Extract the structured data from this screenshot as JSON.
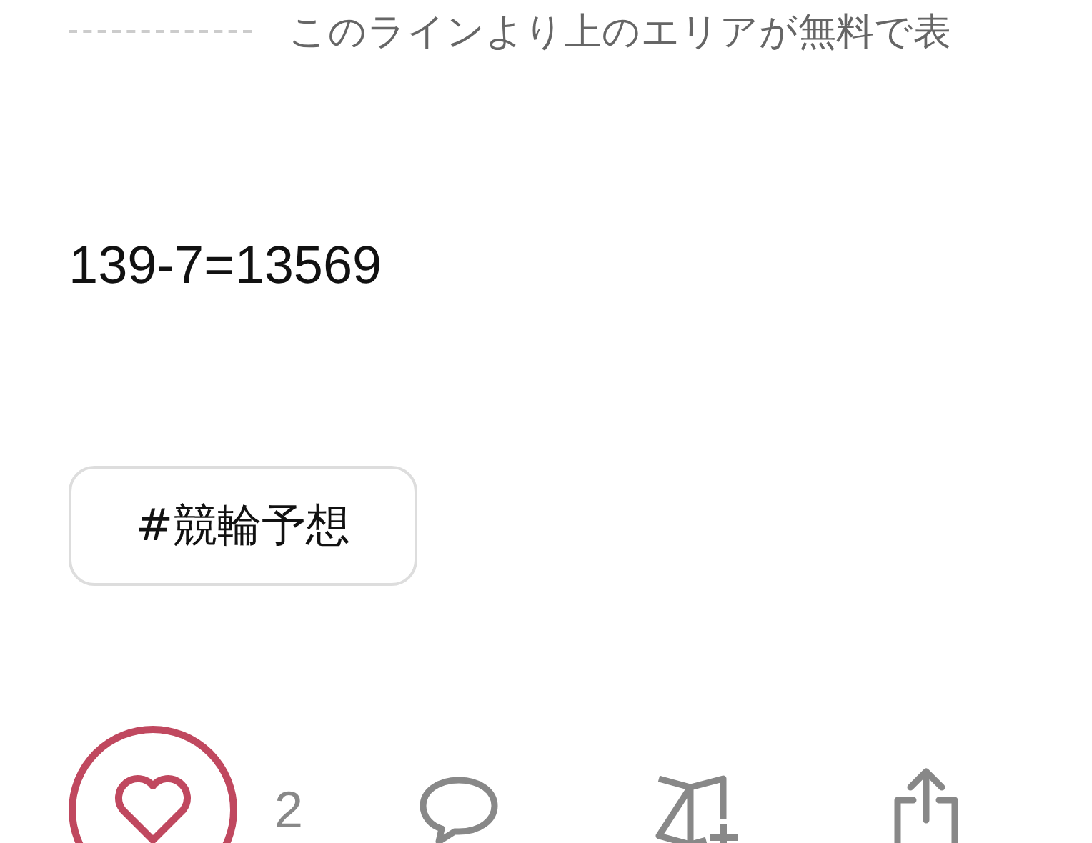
{
  "paywall_notice": {
    "text": "このラインより上のエリアが無料で表"
  },
  "body": {
    "text": "139-7=13569"
  },
  "tags": [
    {
      "label": "#競輪予想"
    }
  ],
  "actions": {
    "liked": true,
    "like_count": "2"
  }
}
